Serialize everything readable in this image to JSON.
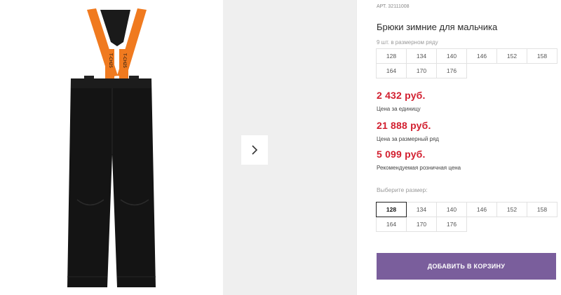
{
  "product": {
    "sku_label": "АРТ.",
    "sku_value": "32111008",
    "title": "Брюки зимние для мальчика",
    "pack_note": "9 шт. в размерном ряду",
    "pack_sizes": [
      "128",
      "134",
      "140",
      "146",
      "152",
      "158",
      "164",
      "170",
      "176"
    ],
    "prices": [
      {
        "value": "2 432 руб.",
        "label": "Цена за единицу"
      },
      {
        "value": "21 888 руб.",
        "label": "Цена за размерный ряд"
      },
      {
        "value": "5 099 руб.",
        "label": "Рекомендуемая розничная цена"
      }
    ],
    "choose_size_label": "Выберите размер:",
    "sizes": [
      "128",
      "134",
      "140",
      "146",
      "152",
      "158",
      "164",
      "170",
      "176"
    ],
    "selected_size": "128",
    "add_to_cart_label": "ДОБАВИТЬ В КОРЗИНУ"
  },
  "image": {
    "suspender_text": "T-CH25",
    "colors": {
      "pants": "#141414",
      "straps": "#f07a1f",
      "button": "#7a5e9c",
      "price": "#d21f2f"
    }
  },
  "icons": {
    "next": "chevron-right-icon"
  }
}
